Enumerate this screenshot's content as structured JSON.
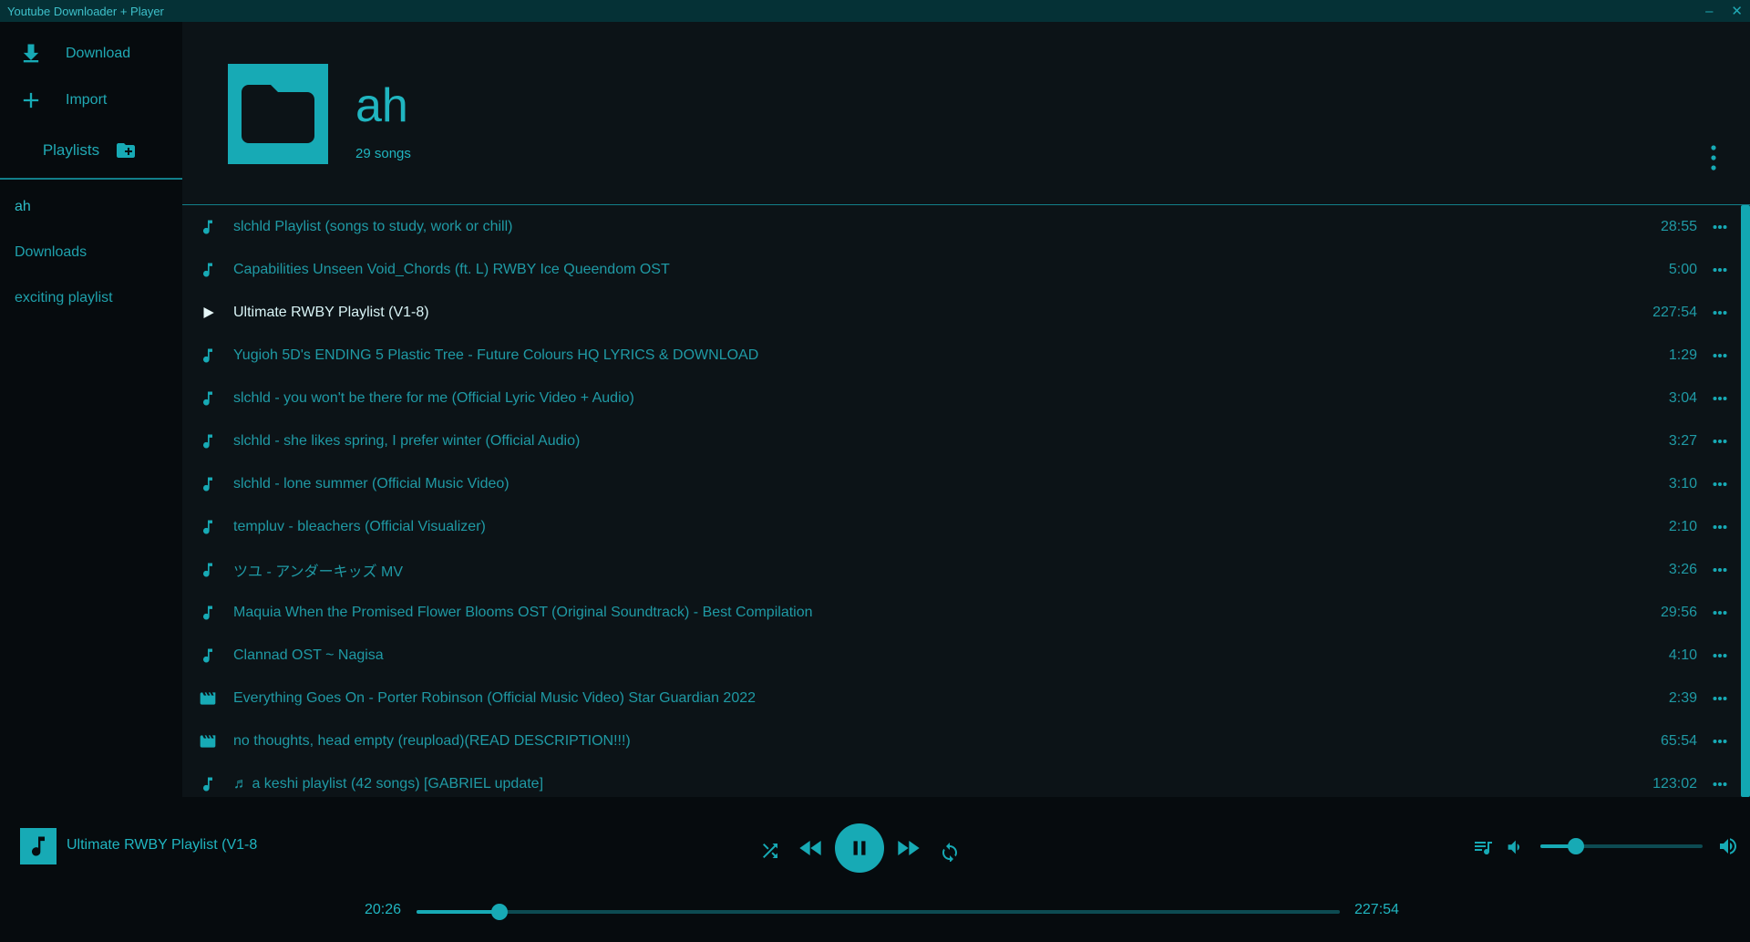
{
  "window": {
    "title": "Youtube Downloader + Player",
    "minimize_label": "–",
    "close_label": "✕"
  },
  "sidebar": {
    "download_label": "Download",
    "import_label": "Import",
    "playlists_label": "Playlists",
    "playlists": [
      "ah",
      "Downloads",
      "exciting playlist"
    ]
  },
  "playlist": {
    "title": "ah",
    "count": "29 songs"
  },
  "songs": [
    {
      "title": "slchld Playlist (songs to study, work or chill)",
      "duration": "28:55",
      "icon": "music-note-icon"
    },
    {
      "title": "Capabilities Unseen Void_Chords (ft. L) RWBY Ice Queendom OST",
      "duration": "5:00",
      "icon": "music-note-icon"
    },
    {
      "title": "Ultimate RWBY Playlist (V1-8)",
      "duration": "227:54",
      "icon": "play-icon",
      "playing": true
    },
    {
      "title": "Yugioh 5D's ENDING 5 Plastic Tree - Future Colours HQ LYRICS & DOWNLOAD",
      "duration": "1:29",
      "icon": "music-note-icon"
    },
    {
      "title": "slchld - you won't be there for me (Official Lyric Video + Audio)",
      "duration": "3:04",
      "icon": "music-note-icon"
    },
    {
      "title": "slchld - she likes spring, I prefer winter (Official Audio)",
      "duration": "3:27",
      "icon": "music-note-icon"
    },
    {
      "title": "slchld - lone summer (Official Music Video)",
      "duration": "3:10",
      "icon": "music-note-icon"
    },
    {
      "title": "templuv - bleachers (Official Visualizer)",
      "duration": "2:10",
      "icon": "music-note-icon"
    },
    {
      "title": "ツユ - アンダーキッズ MV",
      "duration": "3:26",
      "icon": "music-note-icon"
    },
    {
      "title": "Maquia When the Promised Flower Blooms OST (Original Soundtrack) - Best Compilation",
      "duration": "29:56",
      "icon": "music-note-icon"
    },
    {
      "title": "Clannad OST ~ Nagisa",
      "duration": "4:10",
      "icon": "music-note-icon"
    },
    {
      "title": "Everything Goes On - Porter Robinson (Official Music Video) Star Guardian 2022",
      "duration": "2:39",
      "icon": "video-icon"
    },
    {
      "title": "no thoughts, head empty (reupload)(READ DESCRIPTION!!!)",
      "duration": "65:54",
      "icon": "video-icon"
    },
    {
      "title": "♬ a keshi playlist (42 songs) [GABRIEL update]",
      "duration": "123:02",
      "icon": "music-note-icon"
    }
  ],
  "player": {
    "now_playing": "Ultimate RWBY Playlist (V1-8",
    "elapsed": "20:26",
    "total": "227:54",
    "progress": 0.0897,
    "volume": 0.22
  },
  "colors": {
    "accent": "#17aab5",
    "background": "#0c1317",
    "sidebar": "#060b0e",
    "titlebar": "#053136"
  }
}
